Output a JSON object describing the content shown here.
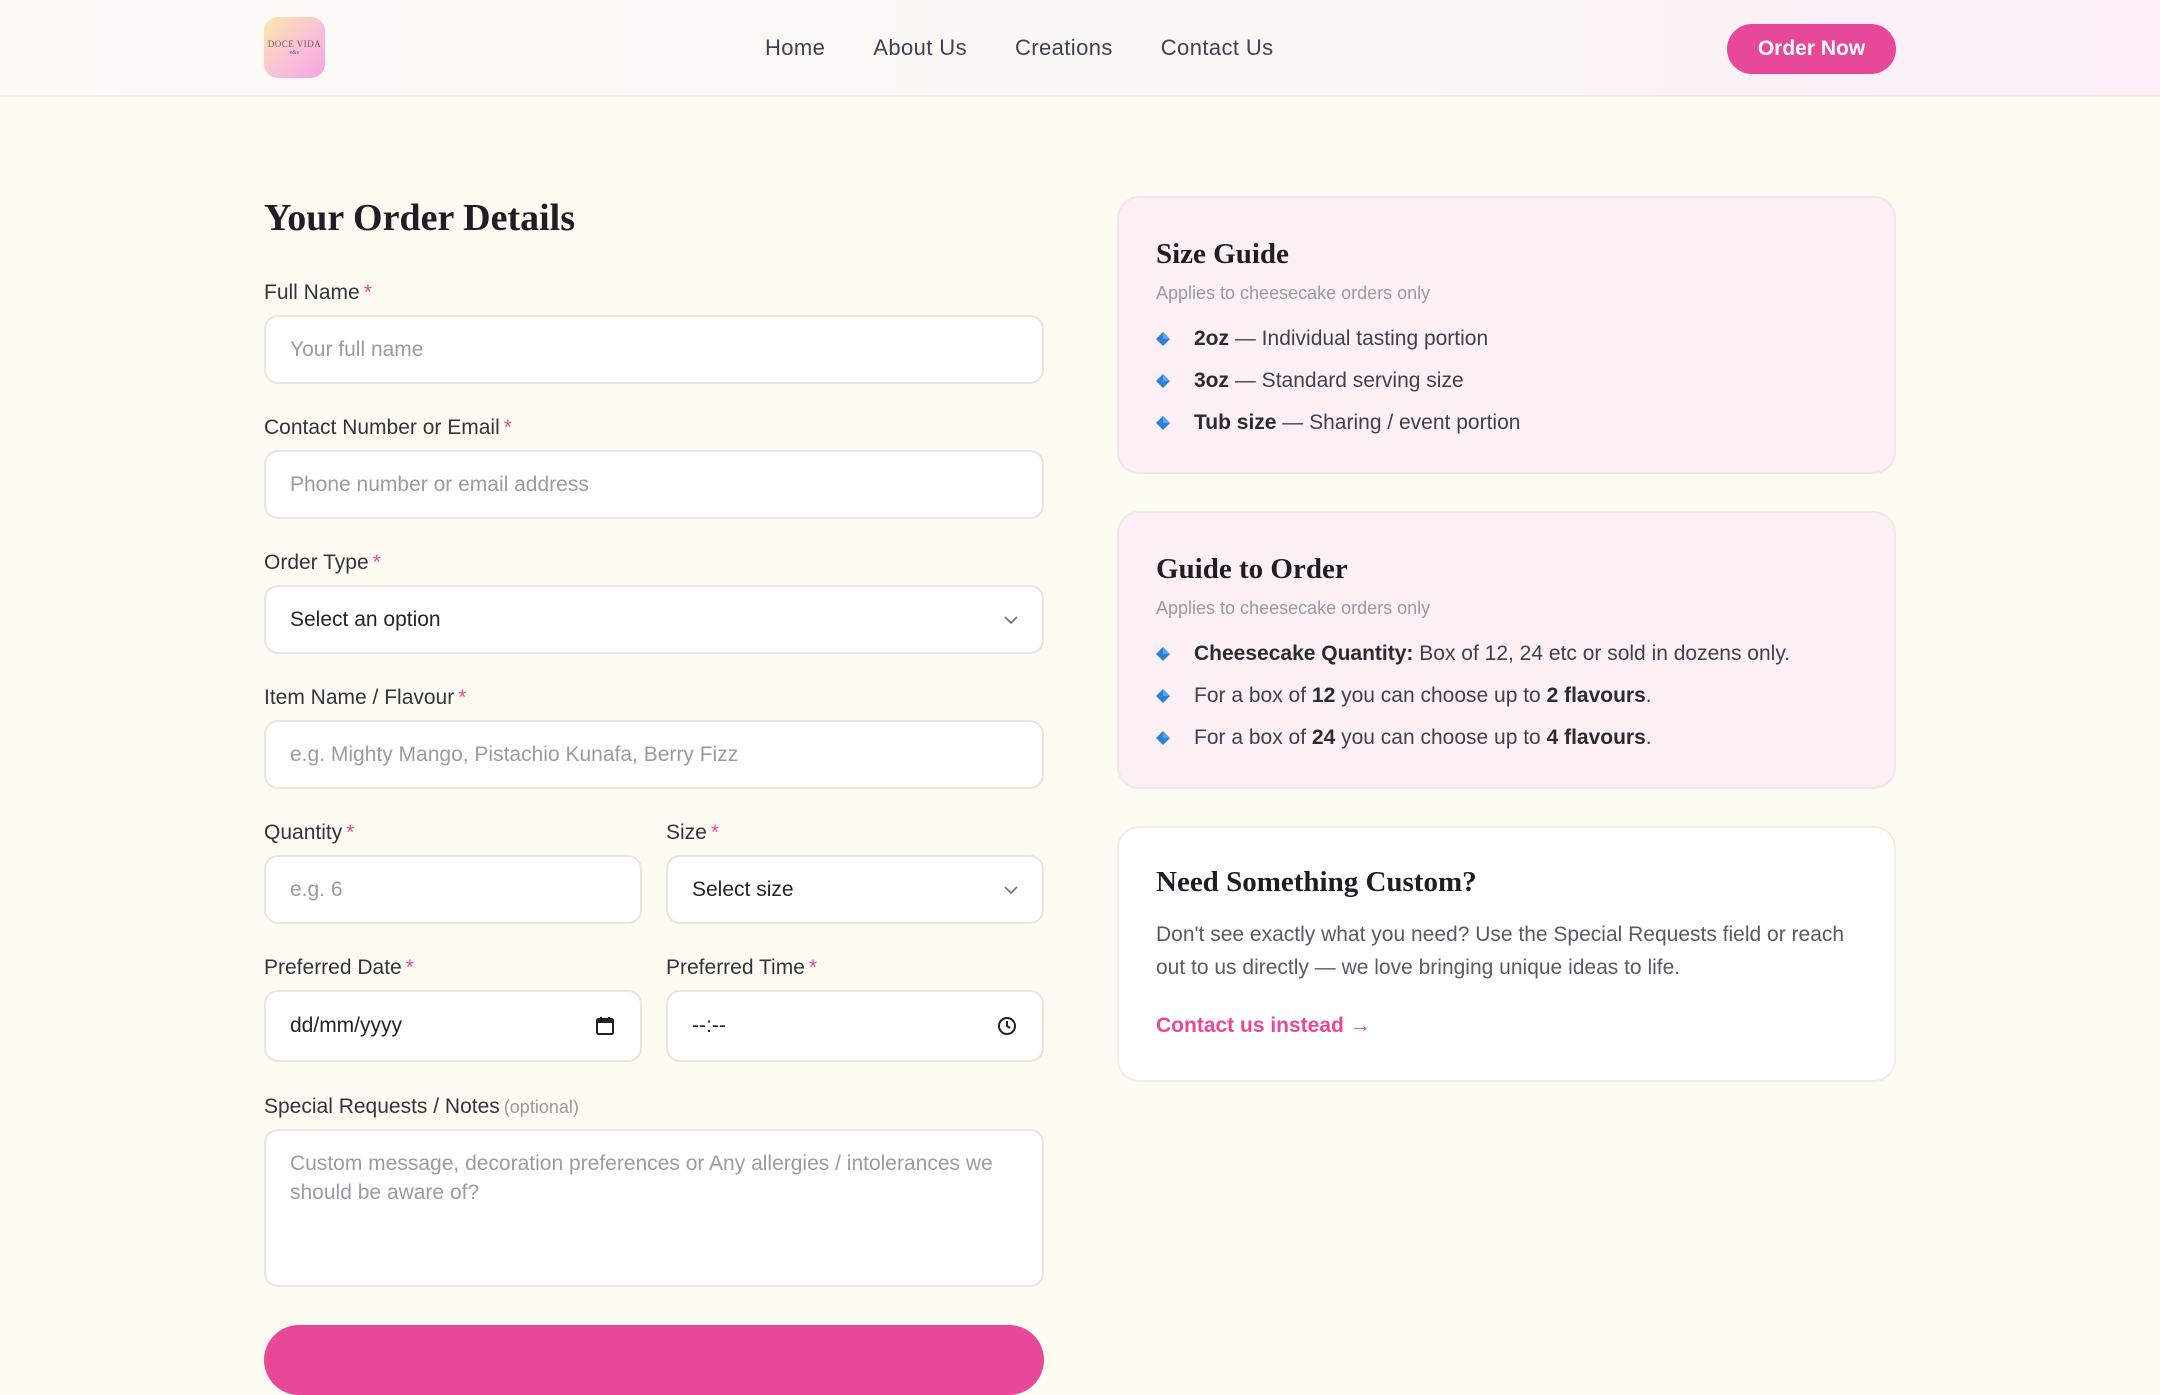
{
  "brand": {
    "logo_text": "DOCE VIDA",
    "logo_sub": "e&e",
    "accent": "#e8489a"
  },
  "nav": {
    "items": [
      "Home",
      "About Us",
      "Creations",
      "Contact Us"
    ],
    "cta": "Order Now"
  },
  "form": {
    "title": "Your Order Details",
    "required_mark": "*",
    "full_name": {
      "label": "Full Name",
      "placeholder": "Your full name"
    },
    "contact": {
      "label": "Contact Number or Email",
      "placeholder": "Phone number or email address"
    },
    "order_type": {
      "label": "Order Type",
      "value": "Select an option"
    },
    "item": {
      "label": "Item Name / Flavour",
      "placeholder": "e.g. Mighty Mango, Pistachio Kunafa, Berry Fizz"
    },
    "quantity": {
      "label": "Quantity",
      "placeholder": "e.g. 6"
    },
    "size": {
      "label": "Size",
      "value": "Select size"
    },
    "date": {
      "label": "Preferred Date",
      "value": "dd/mm/yyyy"
    },
    "time": {
      "label": "Preferred Time",
      "value": "--:--"
    },
    "notes": {
      "label": "Special Requests / Notes",
      "optional": "(optional)",
      "placeholder": "Custom message, decoration preferences or Any allergies / intolerances we should be aware of?"
    }
  },
  "size_guide": {
    "title": "Size Guide",
    "subtitle": "Applies to cheesecake orders only",
    "items": [
      {
        "bold": "2oz",
        "text": " — Individual tasting portion"
      },
      {
        "bold": "3oz",
        "text": " — Standard serving size"
      },
      {
        "bold": "Tub size",
        "text": " — Sharing / event portion"
      }
    ]
  },
  "order_guide": {
    "title": "Guide to Order",
    "subtitle": "Applies to cheesecake orders only",
    "item1": {
      "bold": "Cheesecake Quantity:",
      "text": " Box of 12, 24 etc or sold in dozens only."
    },
    "item2": {
      "a": "For a box of ",
      "b1": "12",
      "c": " you can choose up to ",
      "b2": "2 flavours",
      "d": "."
    },
    "item3": {
      "a": "For a box of ",
      "b1": "24",
      "c": " you can choose up to ",
      "b2": "4 flavours",
      "d": "."
    }
  },
  "custom": {
    "title": "Need Something Custom?",
    "description": "Don't see exactly what you need? Use the Special Requests field or reach out to us directly — we love bringing unique ideas to life.",
    "link": "Contact us instead →"
  }
}
